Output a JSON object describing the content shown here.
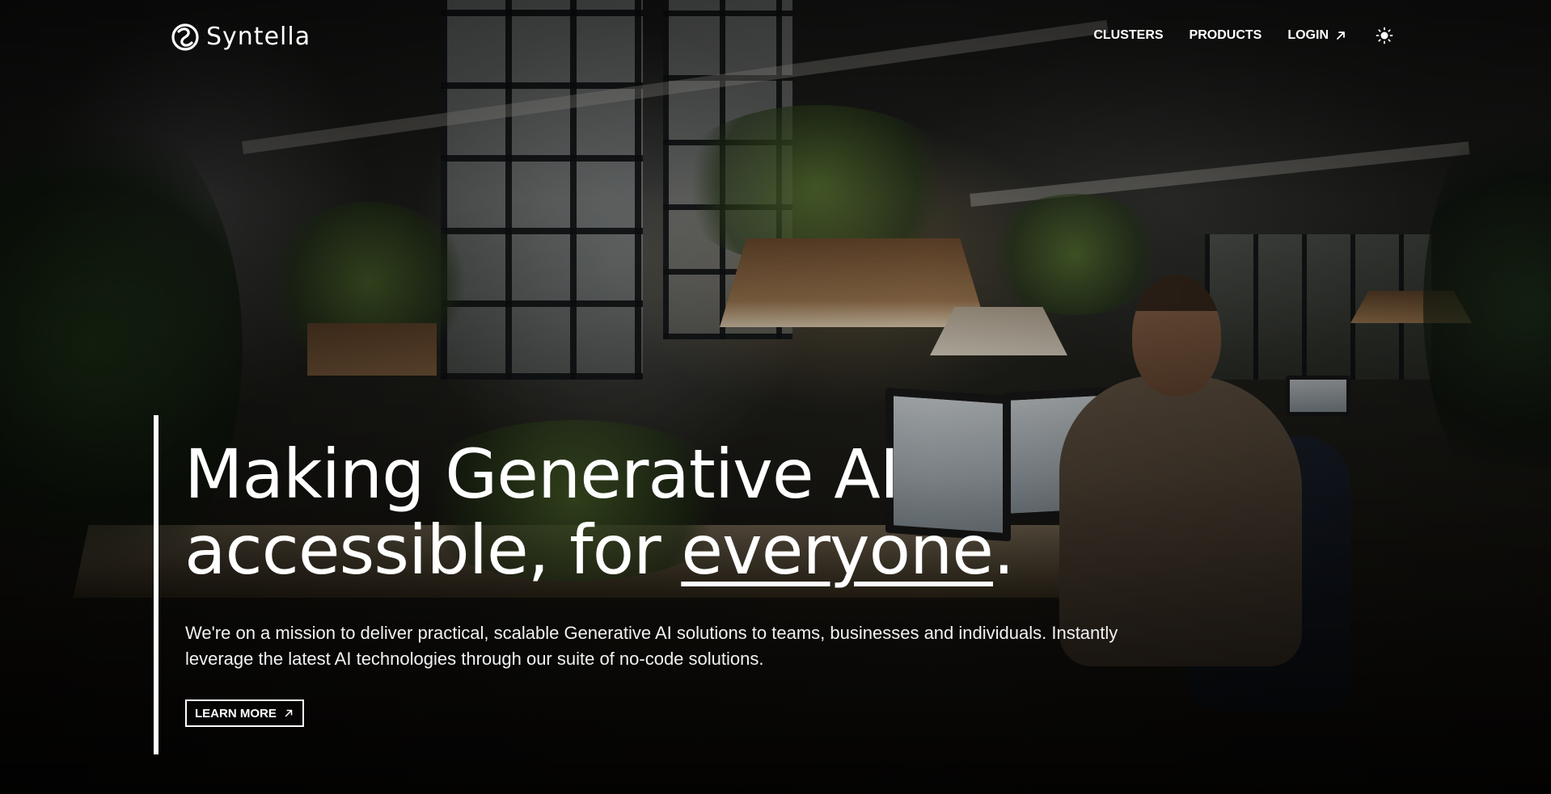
{
  "brand": {
    "name": "Syntella",
    "logo_icon": "syntella-knot-icon"
  },
  "nav": {
    "items": [
      {
        "label": "CLUSTERS",
        "icon": null
      },
      {
        "label": "PRODUCTS",
        "icon": null
      },
      {
        "label": "LOGIN",
        "icon": "external-arrow-icon"
      }
    ],
    "theme_toggle_icon": "sun-icon"
  },
  "hero": {
    "headline_line1": "Making Generative AI",
    "headline_line2_before": "accessible, for ",
    "headline_emphasis": "everyone",
    "headline_after": ".",
    "subcopy": "We're on a mission to deliver practical, scalable Generative AI solutions to teams, businesses and individuals. Instantly leverage the latest AI technologies through our suite of no-code solutions.",
    "cta_label": "LEARN MORE",
    "cta_icon": "external-arrow-icon"
  },
  "colors": {
    "text": "#ffffff",
    "accent_bar": "#ffffff"
  }
}
